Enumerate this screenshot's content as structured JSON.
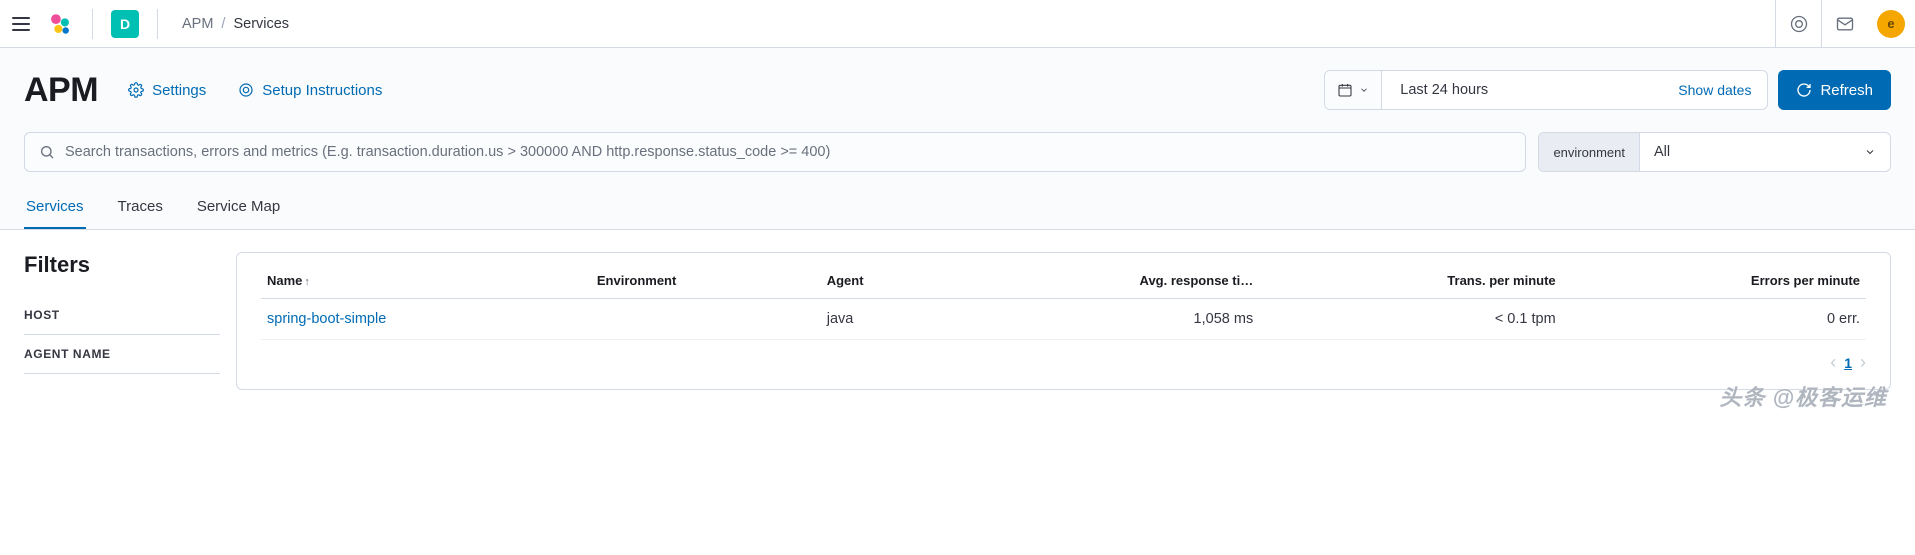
{
  "topbar": {
    "space_letter": "D",
    "breadcrumb_app": "APM",
    "breadcrumb_current": "Services",
    "avatar_letter": "e"
  },
  "header": {
    "title": "APM",
    "settings_label": "Settings",
    "setup_label": "Setup Instructions",
    "date_range": "Last 24 hours",
    "show_dates_label": "Show dates",
    "refresh_label": "Refresh"
  },
  "search": {
    "placeholder": "Search transactions, errors and metrics (E.g. transaction.duration.us > 300000 AND http.response.status_code >= 400)",
    "env_prepend": "environment",
    "env_value": "All"
  },
  "tabs": {
    "services": "Services",
    "traces": "Traces",
    "service_map": "Service Map"
  },
  "filters": {
    "title": "Filters",
    "host": "HOST",
    "agent_name": "AGENT NAME"
  },
  "table": {
    "headers": {
      "name": "Name",
      "environment": "Environment",
      "agent": "Agent",
      "avg_response": "Avg. response ti…",
      "tpm": "Trans. per minute",
      "epm": "Errors per minute"
    },
    "rows": [
      {
        "name": "spring-boot-simple",
        "environment": "",
        "agent": "java",
        "avg_response": "1,058 ms",
        "tpm": "< 0.1 tpm",
        "epm": "0 err."
      }
    ],
    "page_number": "1"
  },
  "watermark": "头条 @极客运维"
}
